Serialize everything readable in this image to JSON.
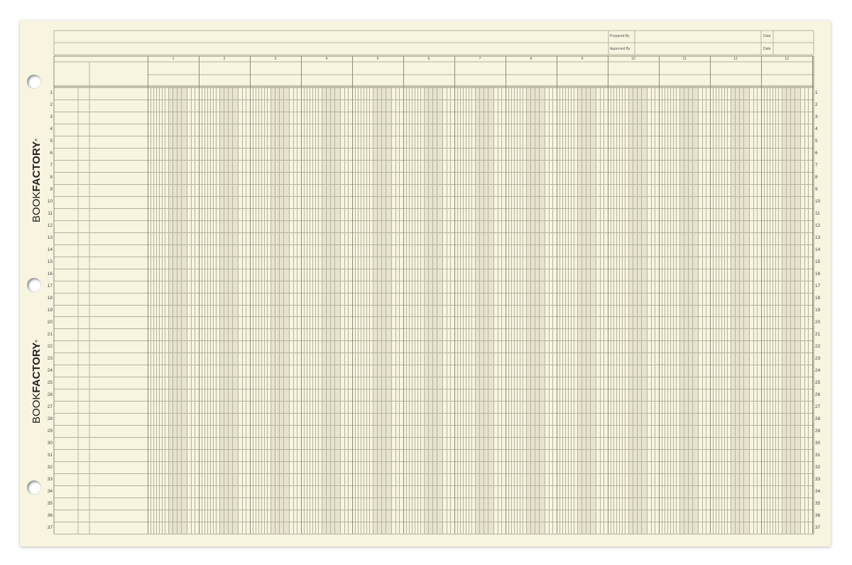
{
  "brand": {
    "light_text": "BOOK",
    "bold_text": "FACTORY",
    "registered_mark": "®"
  },
  "header": {
    "prepared_by_label": "Prepared By",
    "approved_by_label": "Approved By",
    "date_label": "Date"
  },
  "column_numbers": [
    "1",
    "2",
    "3",
    "4",
    "5",
    "6",
    "7",
    "8",
    "9",
    "10",
    "11",
    "12",
    "13"
  ],
  "row_numbers": [
    "1",
    "2",
    "3",
    "4",
    "5",
    "6",
    "7",
    "8",
    "9",
    "10",
    "11",
    "12",
    "13",
    "14",
    "15",
    "16",
    "17",
    "18",
    "19",
    "20",
    "21",
    "22",
    "23",
    "24",
    "25",
    "26",
    "27",
    "28",
    "29",
    "30",
    "31",
    "32",
    "33",
    "34",
    "35",
    "36",
    "37"
  ],
  "colors": {
    "paper": "#f7f4e0",
    "shaded_column": "#e7e3ce",
    "rule_line": "#b5b39c",
    "heavy_line": "#8c8a78"
  }
}
